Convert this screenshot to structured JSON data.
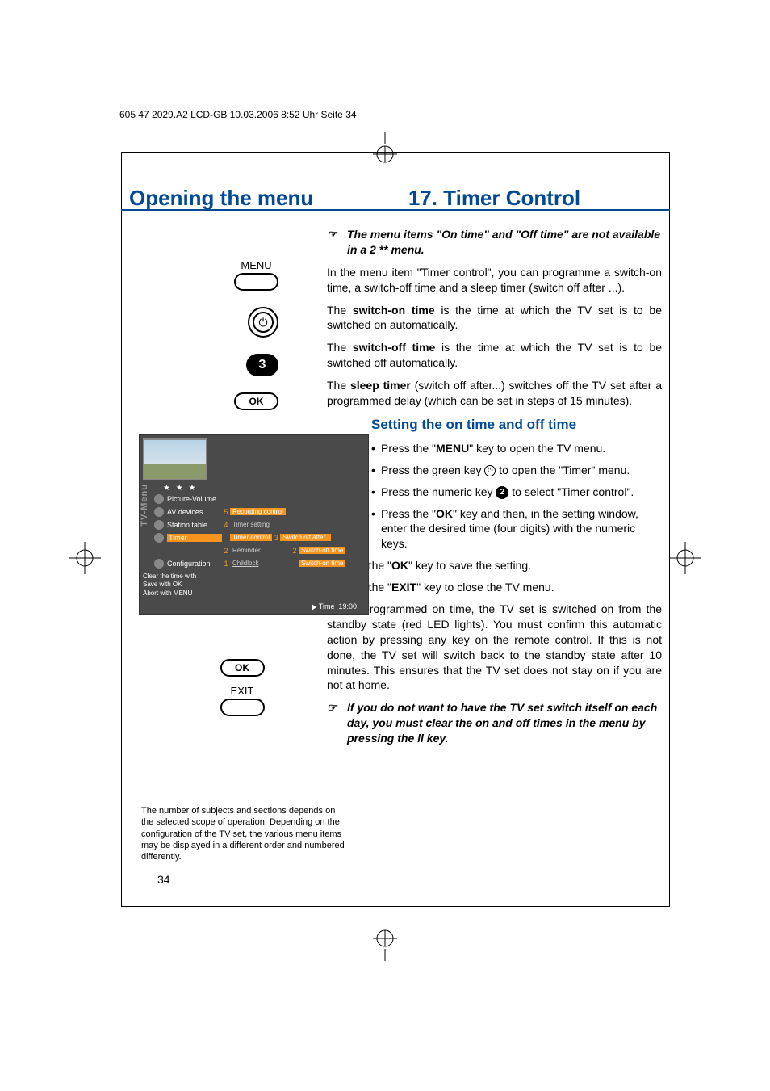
{
  "header": "605 47 2029.A2 LCD-GB  10.03.2006  8:52 Uhr  Seite 34",
  "title_left": "Opening the menu",
  "title_right": "17. Timer Control",
  "remote": {
    "menu": "MENU",
    "number": "3",
    "ok1": "OK",
    "ok2": "OK",
    "exit": "EXIT"
  },
  "tv_menu": {
    "sidebar": "TV-Menu",
    "stars": "★ ★ ★",
    "items": [
      {
        "label": "Picture-Volume"
      },
      {
        "label": "AV devices",
        "num": "5",
        "sub": "Recording control"
      },
      {
        "label": "Station table",
        "num": "4",
        "sub": "Timer setting"
      },
      {
        "label": "Timer",
        "num": "",
        "sub": "Timer control",
        "r_num": "3",
        "r_sub": "Switch off after..",
        "active": true
      },
      {
        "label": "",
        "num": "2",
        "sub": "Reminder",
        "r_num": "2",
        "r_sub": "Switch-off time"
      },
      {
        "label": "Configuration",
        "num": "1",
        "sub": "Childlock",
        "r_num": "",
        "r_sub": "Switch-on time"
      }
    ],
    "help1": "Clear the time with",
    "help2": "Save with OK",
    "help3": "Abort with MENU",
    "time_label": "Time",
    "time_value": "19:00"
  },
  "body": {
    "note1": "The menu items \"On time\" and \"Off time\" are not available in a 2 ** menu.",
    "p1": "In the menu item \"Timer control\", you can programme a switch-on time, a switch-off time and a sleep timer (switch off after ...).",
    "p2_a": "The ",
    "p2_b": "switch-on time",
    "p2_c": " is the time at which the TV set is to be switched on automatically.",
    "p3_a": "The ",
    "p3_b": "switch-off time",
    "p3_c": " is the time at which the TV set is to be switched off automatically.",
    "p4_a": "The ",
    "p4_b": "sleep timer",
    "p4_c": " (switch off after...) switches off the TV set after a programmed delay (which can be set in steps of 15 minutes).",
    "section": "Setting the on time and off time",
    "b1_a": "Press the \"",
    "b1_b": "MENU",
    "b1_c": "\" key to open the TV menu.",
    "b2": "Press the green key       to open the \"Timer\" menu.",
    "b2_a": "Press the green key ",
    "b2_b": " to open the \"Timer\" menu.",
    "b3_a": "Press the numeric key ",
    "b3_b": " to select \"Timer control\".",
    "b3_num": "2",
    "b4_a": "Press the \"",
    "b4_b": "OK",
    "b4_c": "\" key and then, in the setting window, enter the desired time (four digits) with the numeric keys.",
    "b5_a": "Press the \"",
    "b5_b": "OK",
    "b5_c": "\" key to save the setting.",
    "b6_a": "Press the \"",
    "b6_b": "EXIT",
    "b6_c": "\" key to close the TV menu.",
    "p5": "At the programmed on time, the TV set is switched on from the standby state (red LED lights). You must confirm this automatic action by pressing any key on the remote control. If this is not done, the TV set will switch back to the standby state after 10 minutes. This ensures that the TV set does not stay on if you are not at home.",
    "note2": "If you do not want to have the TV set switch itself on each day, you must clear the on and off times in the menu by pressing the ll key."
  },
  "footnote": "The number of subjects and sections depends on the selected scope of operation. Depending on the configuration of the TV set, the various menu items may be displayed in a different order and numbered differently.",
  "page_num": "34",
  "icons": {
    "pointing_hand": "☞",
    "power": "⏻"
  }
}
